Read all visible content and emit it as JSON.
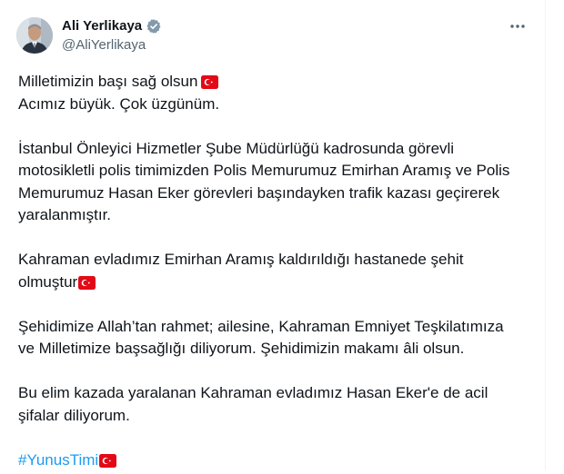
{
  "author": {
    "name": "Ali Yerlikaya",
    "handle": "@AliYerlikaya",
    "verified_badge": "verified-icon",
    "avatar_icon": "avatar"
  },
  "more_menu": {
    "icon": "more-options-icon"
  },
  "colors": {
    "text": "#0f1419",
    "secondary": "#536471",
    "link": "#1d9bf0",
    "flag_red": "#e30a17",
    "badge_gray": "#829aab"
  },
  "tweet": {
    "p1": {
      "l1": "Milletimizin başı sağ olsun",
      "l2": "Acımız büyük. Çok üzgünüm."
    },
    "p2": {
      "l1": "İstanbul Önleyici Hizmetler Şube Müdürlüğü kadrosunda görevli",
      "l2": "motosikletli polis timimizden Polis Memurumuz Emirhan Aramış ve Polis",
      "l3": "Memurumuz Hasan Eker görevleri başındayken trafik kazası geçirerek",
      "l4": "yaralanmıştır."
    },
    "p3": {
      "l1": "Kahraman evladımız Emirhan Aramış kaldırıldığı hastanede şehit",
      "l2": "olmuştur"
    },
    "p4": {
      "l1": "Şehidimize Allah’tan rahmet; ailesine, Kahraman Emniyet Teşkilatımıza",
      "l2": "ve Milletimize başsağlığı diliyorum. Şehidimizin makamı âli olsun."
    },
    "p5": {
      "l1": "Bu elim kazada yaralanan Kahraman evladımız Hasan Eker'e de acil",
      "l2": "şifalar diliyorum."
    },
    "hashtag": "#YunusTimi",
    "flag_emoji_icon": "turkish-flag-icon"
  }
}
